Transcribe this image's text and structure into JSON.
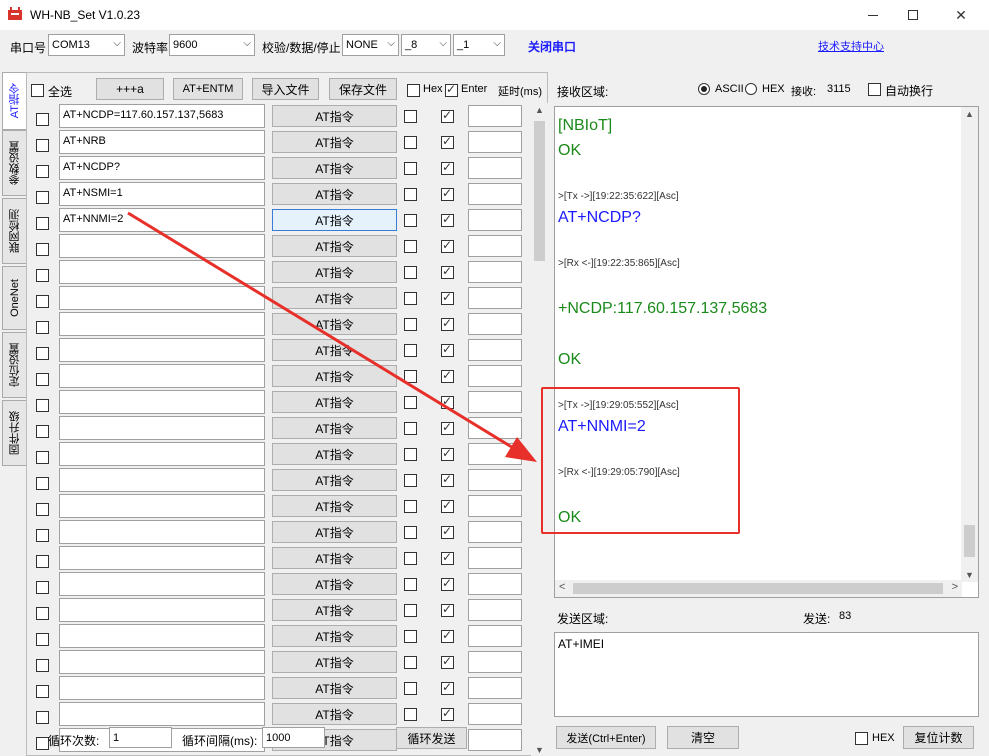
{
  "window": {
    "title": "WH-NB_Set V1.0.23"
  },
  "toolbar": {
    "port_label": "串口号",
    "port_value": "COM13",
    "baud_label": "波特率",
    "baud_value": "9600",
    "check_label": "校验/数据/停止",
    "parity_value": "NONE",
    "databits_value": "_8",
    "stopbits_value": "_1",
    "close_port": "关闭串口",
    "support_link": "技术支持中心"
  },
  "tabs": [
    "AT指令",
    "参数设置",
    "联网检测",
    "OneNet",
    "定位设置",
    "固件升级"
  ],
  "left": {
    "select_all": "全选",
    "btn_plus": "+++a",
    "btn_entm": "AT+ENTM",
    "btn_import": "导入文件",
    "btn_save": "保存文件",
    "hex_label": "Hex",
    "enter_label": "Enter",
    "delay_label": "延时(ms)",
    "at_button_label": "AT指令",
    "commands": [
      "AT+NCDP=117.60.157.137,5683",
      "AT+NRB",
      "AT+NCDP?",
      "AT+NSMI=1",
      "AT+NNMI=2",
      "",
      "",
      "",
      "",
      "",
      "",
      "",
      "",
      "",
      "",
      "",
      "",
      "",
      "",
      "",
      "",
      "",
      "",
      "",
      ""
    ]
  },
  "bottom": {
    "loop_count_label": "循环次数:",
    "loop_count_value": "1",
    "loop_interval_label": "循环间隔(ms):",
    "loop_interval_value": "1000",
    "loop_send": "循环发送"
  },
  "right": {
    "recv_label": "接收区域:",
    "ascii": "ASCII",
    "hex": "HEX",
    "recv_count_label": "接收:",
    "recv_count": "3115",
    "auto_wrap": "自动换行",
    "log": {
      "l1": "[NBIoT]",
      "l2": "OK",
      "t1": ">[Tx ->][19:22:35:622][Asc]",
      "l3": "AT+NCDP?",
      "t2": ">[Rx <-][19:22:35:865][Asc]",
      "l4": "+NCDP:117.60.157.137,5683",
      "l5": "OK",
      "t3": ">[Tx ->][19:29:05:552][Asc]",
      "l6": "AT+NNMI=2",
      "t4": ">[Rx <-][19:29:05:790][Asc]",
      "l7": "OK"
    },
    "send_label": "发送区域:",
    "send_count_label": "发送:",
    "send_count": "83",
    "send_text": "AT+IMEI",
    "btn_send": "发送(Ctrl+Enter)",
    "btn_clear": "清空",
    "hex_label": "HEX",
    "btn_reset": "复位计数"
  },
  "colors": {
    "accent_blue": "#1a1aff",
    "log_green": "#1a8a1a",
    "annotation_red": "#e8302a"
  }
}
